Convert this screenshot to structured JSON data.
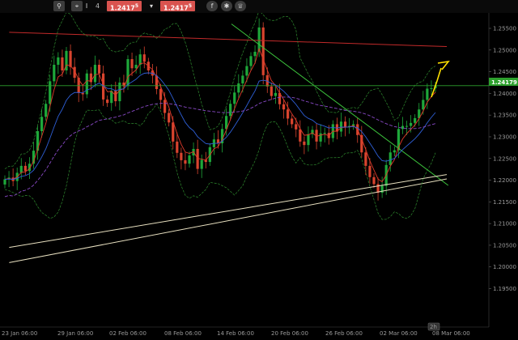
{
  "toolbar": {
    "bid": "1.2417",
    "bid_sup": "5",
    "ask": "1.2417",
    "ask_sup": "5",
    "value": "4",
    "colors": {
      "bg": "#0a0a0a",
      "button": "#3c3c3c",
      "price": "#d9534f"
    },
    "icons": [
      "search-icon",
      "zoom-icon",
      "text-icon",
      "chevron-down-icon",
      "facebook-icon",
      "twitter-icon",
      "crown-icon"
    ]
  },
  "chart_data": {
    "type": "candlestick",
    "instrument_last_price": "1.24179",
    "ylim": [
      1.1895,
      1.2578
    ],
    "y_ticks": [
      "1.25500",
      "1.25000",
      "1.24500",
      "1.24000",
      "1.23500",
      "1.23000",
      "1.22500",
      "1.22000",
      "1.21500",
      "1.21000",
      "1.20500",
      "1.20000",
      "1.19500"
    ],
    "x_ticks": [
      "23 Jan 06:00",
      "29 Jan 06:00",
      "02 Feb 06:00",
      "08 Feb 06:00",
      "14 Feb 06:00",
      "20 Feb 06:00",
      "26 Feb 06:00",
      "02 Mar 06:00",
      "08 Mar 06:00"
    ],
    "timeframe_badge": "2h",
    "colors": {
      "up": "#1ea83a",
      "down": "#d9442e",
      "bollinger": "#2e8a2e",
      "ema_fast": "#e03a2a",
      "ema_slow": "#2e5fd6",
      "ma_long": "#8a4ac8",
      "resistance": "#c22a2a",
      "trendline": "#3cc43c",
      "support": "#e8e0c0",
      "arrow": "#ffe000",
      "price_line": "#2da02d"
    },
    "candles_close": [
      1.2202,
      1.2206,
      1.2198,
      1.2217,
      1.2233,
      1.2221,
      1.2238,
      1.2268,
      1.2313,
      1.2346,
      1.2376,
      1.2428,
      1.2466,
      1.2483,
      1.2453,
      1.2498,
      1.2461,
      1.2436,
      1.2401,
      1.2398,
      1.2446,
      1.2426,
      1.2466,
      1.2446,
      1.2386,
      1.2378,
      1.2406,
      1.2382,
      1.2425,
      1.2417,
      1.2479,
      1.2458,
      1.2466,
      1.249,
      1.2473,
      1.2453,
      1.2441,
      1.241,
      1.2385,
      1.2355,
      1.2333,
      1.2289,
      1.2263,
      1.2246,
      1.2238,
      1.2257,
      1.2272,
      1.2226,
      1.2247,
      1.2242,
      1.2276,
      1.2294,
      1.2285,
      1.2318,
      1.2348,
      1.2376,
      1.2402,
      1.2423,
      1.2441,
      1.2463,
      1.2486,
      1.2496,
      1.2552,
      1.2442,
      1.2416,
      1.2394,
      1.2401,
      1.2375,
      1.2363,
      1.2342,
      1.2329,
      1.2317,
      1.2289,
      1.2281,
      1.2306,
      1.2316,
      1.2289,
      1.2308,
      1.2309,
      1.2297,
      1.2329,
      1.2312,
      1.2335,
      1.2322,
      1.2325,
      1.2329,
      1.2304,
      1.2264,
      1.2233,
      1.2207,
      1.2191,
      1.2171,
      1.2187,
      1.2235,
      1.2264,
      1.2269,
      1.2318,
      1.2325,
      1.2325,
      1.2332,
      1.2343,
      1.2363,
      1.2385,
      1.2411,
      1.2412,
      1.2418
    ],
    "lines": [
      {
        "name": "resistance",
        "x": [
          "22 Jan 12:00",
          "08 Mar 06:00"
        ],
        "y": [
          1.2541,
          1.2508
        ]
      },
      {
        "name": "downtrend",
        "x": [
          "14 Feb 06:00",
          "08 Mar 10:00"
        ],
        "y": [
          1.256,
          1.2188
        ]
      },
      {
        "name": "support-1",
        "x": [
          "22 Jan 12:00",
          "08 Mar 06:00"
        ],
        "y": [
          1.2045,
          1.2213
        ]
      },
      {
        "name": "support-2",
        "x": [
          "22 Jan 12:00",
          "08 Mar 06:00"
        ],
        "y": [
          1.201,
          1.2203
        ]
      },
      {
        "name": "price-line",
        "y": [
          1.24179
        ]
      }
    ]
  }
}
